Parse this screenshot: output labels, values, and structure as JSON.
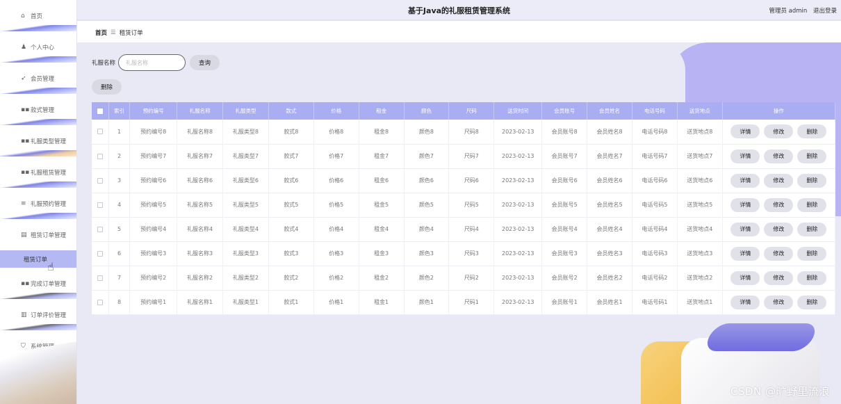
{
  "app": {
    "title": "基于Java的礼服租赁管理系统",
    "user_label": "管理员 admin",
    "logout_label": "退出登录"
  },
  "sidebar": {
    "items": [
      {
        "label": "首页",
        "icon": "home-icon",
        "glyph": "⌂"
      },
      {
        "label": "个人中心",
        "icon": "person-icon",
        "glyph": "♟"
      },
      {
        "label": "会员管理",
        "icon": "send-icon",
        "glyph": "➶"
      },
      {
        "label": "款式管理",
        "icon": "grid-icon",
        "glyph": "▪▪"
      },
      {
        "label": "礼服类型管理",
        "icon": "grid-icon",
        "glyph": "▪▪"
      },
      {
        "label": "礼服租赁管理",
        "icon": "grid-icon",
        "glyph": "▪▪"
      },
      {
        "label": "礼服预约管理",
        "icon": "stack-icon",
        "glyph": "≡"
      },
      {
        "label": "租赁订单管理",
        "icon": "doc-icon",
        "glyph": "▤"
      },
      {
        "label": "完成订单管理",
        "icon": "grid-icon",
        "glyph": "▪▪"
      },
      {
        "label": "订单评价管理",
        "icon": "chart-icon",
        "glyph": "▥"
      },
      {
        "label": "系统管理",
        "icon": "shield-icon",
        "glyph": "⛉"
      }
    ],
    "active_sub": "租赁订单"
  },
  "breadcrumb": {
    "home": "首页",
    "separator": "☰",
    "current": "租赁订单"
  },
  "search": {
    "label": "礼服名称",
    "placeholder": "礼服名称",
    "value": "",
    "button": "查询"
  },
  "toolbar": {
    "delete_label": "删除"
  },
  "table": {
    "headers": [
      "",
      "索引",
      "预约编号",
      "礼服名称",
      "礼服类型",
      "款式",
      "价格",
      "租金",
      "颜色",
      "尺码",
      "送货时间",
      "会员账号",
      "会员姓名",
      "电话号码",
      "送货地点",
      "操作"
    ],
    "rows": [
      [
        "1",
        "预约编号8",
        "礼服名称8",
        "礼服类型8",
        "款式8",
        "价格8",
        "租金8",
        "颜色8",
        "尺码8",
        "2023-02-13",
        "会员账号8",
        "会员姓名8",
        "电话号码8",
        "送货地点8"
      ],
      [
        "2",
        "预约编号7",
        "礼服名称7",
        "礼服类型7",
        "款式7",
        "价格7",
        "租金7",
        "颜色7",
        "尺码7",
        "2023-02-13",
        "会员账号7",
        "会员姓名7",
        "电话号码7",
        "送货地点7"
      ],
      [
        "3",
        "预约编号6",
        "礼服名称6",
        "礼服类型6",
        "款式6",
        "价格6",
        "租金6",
        "颜色6",
        "尺码6",
        "2023-02-13",
        "会员账号6",
        "会员姓名6",
        "电话号码6",
        "送货地点6"
      ],
      [
        "4",
        "预约编号5",
        "礼服名称5",
        "礼服类型5",
        "款式5",
        "价格5",
        "租金5",
        "颜色5",
        "尺码5",
        "2023-02-13",
        "会员账号5",
        "会员姓名5",
        "电话号码5",
        "送货地点5"
      ],
      [
        "5",
        "预约编号4",
        "礼服名称4",
        "礼服类型4",
        "款式4",
        "价格4",
        "租金4",
        "颜色4",
        "尺码4",
        "2023-02-13",
        "会员账号4",
        "会员姓名4",
        "电话号码4",
        "送货地点4"
      ],
      [
        "6",
        "预约编号3",
        "礼服名称3",
        "礼服类型3",
        "款式3",
        "价格3",
        "租金3",
        "颜色3",
        "尺码3",
        "2023-02-13",
        "会员账号3",
        "会员姓名3",
        "电话号码3",
        "送货地点3"
      ],
      [
        "7",
        "预约编号2",
        "礼服名称2",
        "礼服类型2",
        "款式2",
        "价格2",
        "租金2",
        "颜色2",
        "尺码2",
        "2023-02-13",
        "会员账号2",
        "会员姓名2",
        "电话号码2",
        "送货地点2"
      ],
      [
        "8",
        "预约编号1",
        "礼服名称1",
        "礼服类型1",
        "款式1",
        "价格1",
        "租金1",
        "颜色1",
        "尺码1",
        "2023-02-13",
        "会员账号1",
        "会员姓名1",
        "电话号码1",
        "送货地点1"
      ]
    ],
    "actions": [
      "详情",
      "修改",
      "删除"
    ]
  },
  "watermark": "CSDN @旷野里流浪",
  "colors": {
    "accent": "#a8aef1",
    "header_bg": "#ebecf8",
    "main_bg": "#e9e9f6",
    "active_sub_bg": "#b5b9f3"
  }
}
